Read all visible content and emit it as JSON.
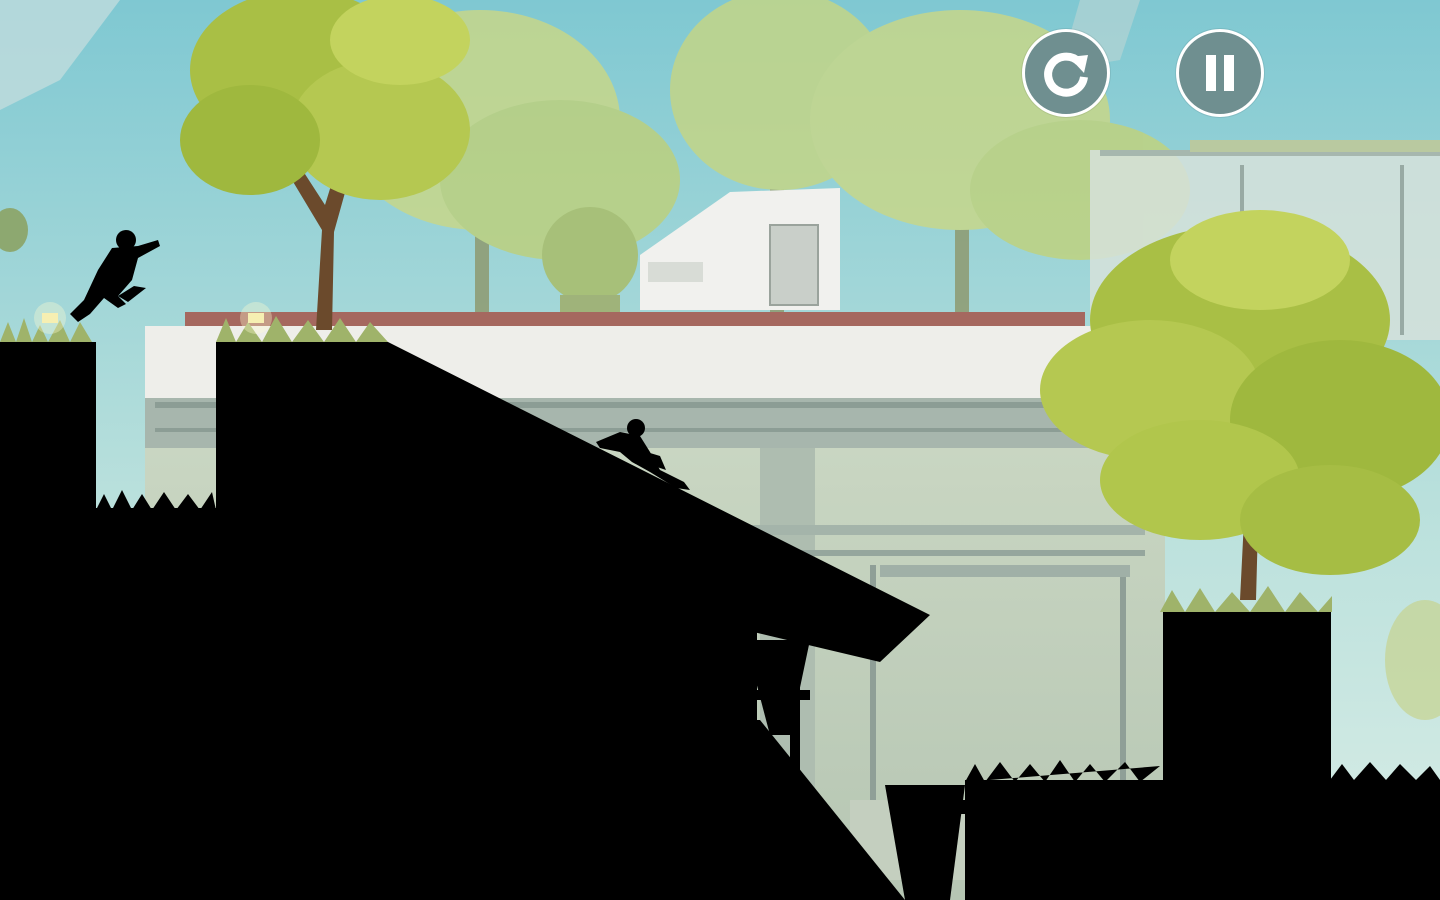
{
  "hud": {
    "restart_icon": "restart-icon",
    "pause_icon": "pause-icon"
  },
  "colors": {
    "sky_top": "#7fc8d2",
    "sky_bottom": "#d9ede6",
    "silhouette": "#000000",
    "hud_button_fill": "#6f8f90",
    "hud_button_border": "#ffffff",
    "foliage": "#a9bf45",
    "building_wall": "#eeeeea"
  },
  "characters": [
    "runner-silhouette",
    "hunter-silhouette"
  ]
}
